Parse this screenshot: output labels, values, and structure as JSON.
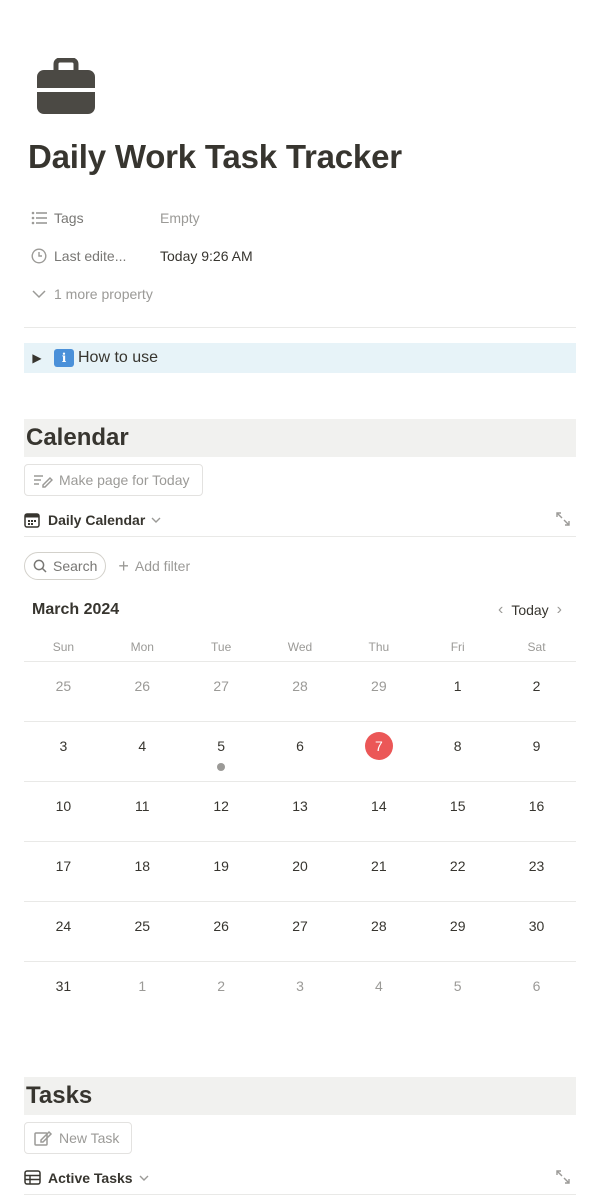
{
  "page": {
    "icon": "briefcase-icon",
    "title": "Daily Work Task Tracker"
  },
  "properties": {
    "tags_label": "Tags",
    "tags_value": "Empty",
    "last_edited_label": "Last edite...",
    "last_edited_value": "Today 9:26 AM",
    "more_label": "1 more property"
  },
  "toggle": {
    "emoji": "i",
    "label": "How to use"
  },
  "calendar_section": {
    "heading": "Calendar",
    "action_button": "Make page for Today",
    "view_name": "Daily Calendar",
    "search_label": "Search",
    "add_filter_label": "Add filter",
    "month_label": "March 2024",
    "today_label": "Today",
    "weekdays": [
      "Sun",
      "Mon",
      "Tue",
      "Wed",
      "Thu",
      "Fri",
      "Sat"
    ],
    "weeks": [
      [
        {
          "d": "25",
          "m": true
        },
        {
          "d": "26",
          "m": true
        },
        {
          "d": "27",
          "m": true
        },
        {
          "d": "28",
          "m": true
        },
        {
          "d": "29",
          "m": true
        },
        {
          "d": "1"
        },
        {
          "d": "2"
        }
      ],
      [
        {
          "d": "3"
        },
        {
          "d": "4"
        },
        {
          "d": "5",
          "dot": true
        },
        {
          "d": "6"
        },
        {
          "d": "7",
          "today": true
        },
        {
          "d": "8"
        },
        {
          "d": "9"
        }
      ],
      [
        {
          "d": "10"
        },
        {
          "d": "11"
        },
        {
          "d": "12"
        },
        {
          "d": "13"
        },
        {
          "d": "14"
        },
        {
          "d": "15"
        },
        {
          "d": "16"
        }
      ],
      [
        {
          "d": "17"
        },
        {
          "d": "18"
        },
        {
          "d": "19"
        },
        {
          "d": "20"
        },
        {
          "d": "21"
        },
        {
          "d": "22"
        },
        {
          "d": "23"
        }
      ],
      [
        {
          "d": "24"
        },
        {
          "d": "25"
        },
        {
          "d": "26"
        },
        {
          "d": "27"
        },
        {
          "d": "28"
        },
        {
          "d": "29"
        },
        {
          "d": "30"
        }
      ],
      [
        {
          "d": "31"
        },
        {
          "d": "1",
          "m": true
        },
        {
          "d": "2",
          "m": true
        },
        {
          "d": "3",
          "m": true
        },
        {
          "d": "4",
          "m": true
        },
        {
          "d": "5",
          "m": true
        },
        {
          "d": "6",
          "m": true
        }
      ]
    ]
  },
  "tasks_section": {
    "heading": "Tasks",
    "action_button": "New Task",
    "view_name": "Active Tasks"
  },
  "colors": {
    "today_highlight": "#eb5757",
    "toggle_background": "#e7f3f8",
    "heading_background": "#f1f1ef"
  }
}
